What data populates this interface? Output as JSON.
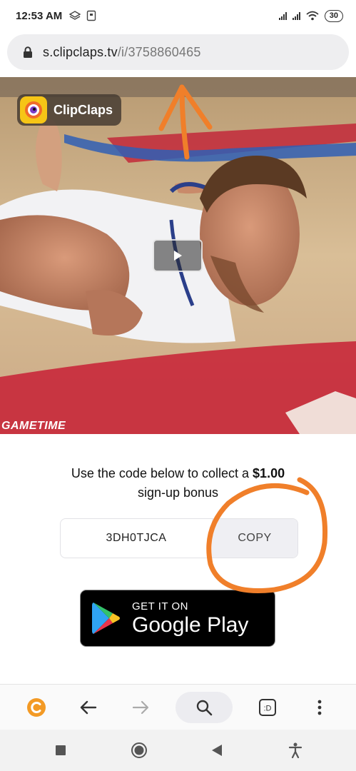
{
  "status": {
    "time": "12:53 AM",
    "battery": "30"
  },
  "browser": {
    "url_domain": "s.clipclaps.tv",
    "url_path": "/i/3758860465"
  },
  "video": {
    "brand_name": "ClipClaps",
    "watermark": "GAMETIME"
  },
  "promo": {
    "line1_prefix": "Use the code below to collect a ",
    "amount": "$1.00",
    "line2": "sign-up bonus"
  },
  "code": {
    "value": "3DH0TJCA",
    "copy_label": "COPY"
  },
  "store_badge": {
    "small": "GET IT ON",
    "big": "Google Play"
  },
  "toolbar": {
    "tab_label": ":D"
  },
  "colors": {
    "annotation": "#f07f2a",
    "brand_yellow": "#f6c516",
    "toolbar_logo": "#f39a25"
  }
}
